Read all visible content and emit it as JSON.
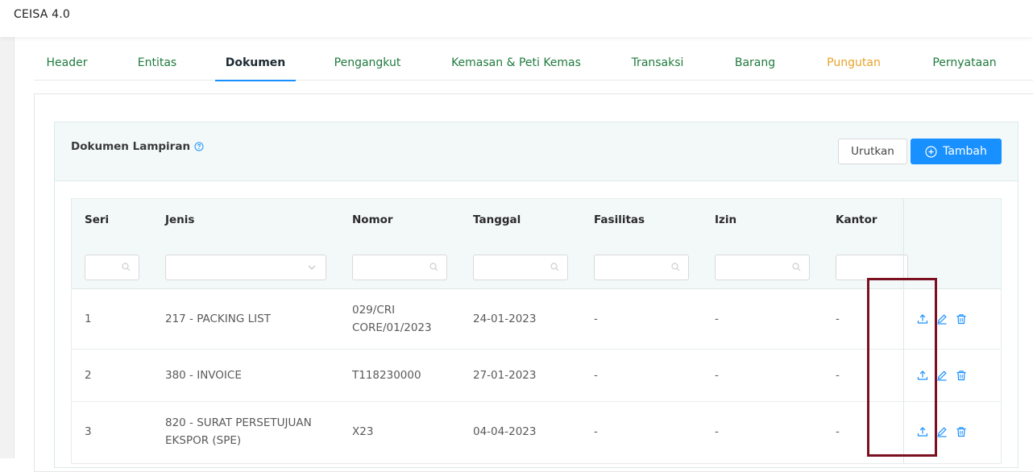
{
  "app": {
    "title": "CEISA 4.0"
  },
  "tabs": [
    {
      "label": "Header"
    },
    {
      "label": "Entitas"
    },
    {
      "label": "Dokumen"
    },
    {
      "label": "Pengangkut"
    },
    {
      "label": "Kemasan & Peti Kemas"
    },
    {
      "label": "Transaksi"
    },
    {
      "label": "Barang"
    },
    {
      "label": "Pungutan"
    },
    {
      "label": "Pernyataan"
    }
  ],
  "active_tab": "Dokumen",
  "section": {
    "title": "Dokumen Lampiran",
    "sort_label": "Urutkan",
    "add_label": "Tambah"
  },
  "table": {
    "columns": [
      "Seri",
      "Jenis",
      "Nomor",
      "Tanggal",
      "Fasilitas",
      "Izin",
      "Kantor"
    ],
    "rows": [
      {
        "seri": "1",
        "jenis": "217 - PACKING LIST",
        "nomor": "029/CRI CORE/01/2023",
        "tanggal": "24-01-2023",
        "fasilitas": "-",
        "izin": "-",
        "kantor": "-"
      },
      {
        "seri": "2",
        "jenis": "380 - INVOICE",
        "nomor": "T118230000",
        "tanggal": "27-01-2023",
        "fasilitas": "-",
        "izin": "-",
        "kantor": "-"
      },
      {
        "seri": "3",
        "jenis": "820 - SURAT PERSETUJUAN EKSPOR (SPE)",
        "nomor": "X23",
        "tanggal": "04-04-2023",
        "fasilitas": "-",
        "izin": "-",
        "kantor": "-"
      }
    ]
  },
  "icons": {
    "help": "help-circle-icon",
    "add": "plus-circle-icon",
    "search": "search-icon",
    "dropdown": "chevron-down-icon",
    "upload": "upload-icon",
    "edit": "edit-icon",
    "delete": "trash-icon"
  },
  "colors": {
    "tab_text": "#1f7a3e",
    "tab_warning": "#e8a32a",
    "primary": "#1890ff",
    "header_bg": "#f3f9f9",
    "highlight": "#7a1020"
  }
}
